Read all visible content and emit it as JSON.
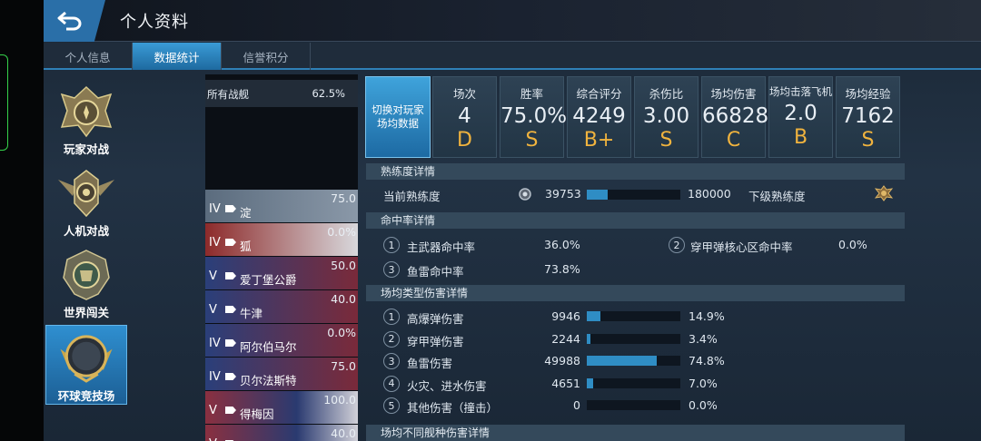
{
  "header": {
    "title": "个人资料"
  },
  "tabs": [
    "个人信息",
    "数据统计",
    "信誉积分"
  ],
  "modes": [
    "玩家对战",
    "人机对战",
    "世界闯关",
    "环球竞技场"
  ],
  "ships_header": {
    "label": "所有战舰",
    "value": "62.5%"
  },
  "ships": [
    {
      "tier": "IV",
      "name": "淀",
      "value": "75.0"
    },
    {
      "tier": "IV",
      "name": "狐",
      "value": "0.0%"
    },
    {
      "tier": "V",
      "name": "爱丁堡公爵",
      "value": "50.0"
    },
    {
      "tier": "V",
      "name": "牛津",
      "value": "40.0"
    },
    {
      "tier": "IV",
      "name": "阿尔伯马尔",
      "value": "0.0%"
    },
    {
      "tier": "IV",
      "name": "贝尔法斯特",
      "value": "75.0"
    },
    {
      "tier": "V",
      "name": "得梅因",
      "value": "100.0"
    },
    {
      "tier": "V",
      "name": "",
      "value": "40.0"
    }
  ],
  "switch_button": "切换对玩家场均数据",
  "stats": [
    {
      "label": "场次",
      "value": "4",
      "grade": "D"
    },
    {
      "label": "胜率",
      "value": "75.0%",
      "grade": "S"
    },
    {
      "label": "综合评分",
      "value": "4249",
      "grade": "B+"
    },
    {
      "label": "杀伤比",
      "value": "3.00",
      "grade": "S"
    },
    {
      "label": "场均伤害",
      "value": "66828",
      "grade": "C"
    },
    {
      "label": "场均击落飞机",
      "value": "2.0",
      "grade": "B"
    },
    {
      "label": "场均经验",
      "value": "7162",
      "grade": "S"
    }
  ],
  "proficiency": {
    "section": "熟练度详情",
    "current_label": "当前熟练度",
    "current": "39753",
    "next": "180000",
    "next_label": "下级熟练度",
    "progress": 0.22
  },
  "hit_rate": {
    "section": "命中率详情",
    "items": [
      {
        "n": "1",
        "label": "主武器命中率",
        "value": "36.0%"
      },
      {
        "n": "2",
        "label": "穿甲弹核心区命中率",
        "value": "0.0%"
      },
      {
        "n": "3",
        "label": "鱼雷命中率",
        "value": "73.8%"
      }
    ]
  },
  "damage": {
    "section": "场均类型伤害详情",
    "items": [
      {
        "n": "1",
        "label": "高爆弹伤害",
        "value": "9946",
        "pct": "14.9%",
        "frac": 0.149
      },
      {
        "n": "2",
        "label": "穿甲弹伤害",
        "value": "2244",
        "pct": "3.4%",
        "frac": 0.034
      },
      {
        "n": "3",
        "label": "鱼雷伤害",
        "value": "49988",
        "pct": "74.8%",
        "frac": 0.748
      },
      {
        "n": "4",
        "label": "火灾、进水伤害",
        "value": "4651",
        "pct": "7.0%",
        "frac": 0.07
      },
      {
        "n": "5",
        "label": "其他伤害（撞击）",
        "value": "0",
        "pct": "0.0%",
        "frac": 0
      }
    ]
  },
  "ship_type_section": "场均不同舰种伤害详情"
}
